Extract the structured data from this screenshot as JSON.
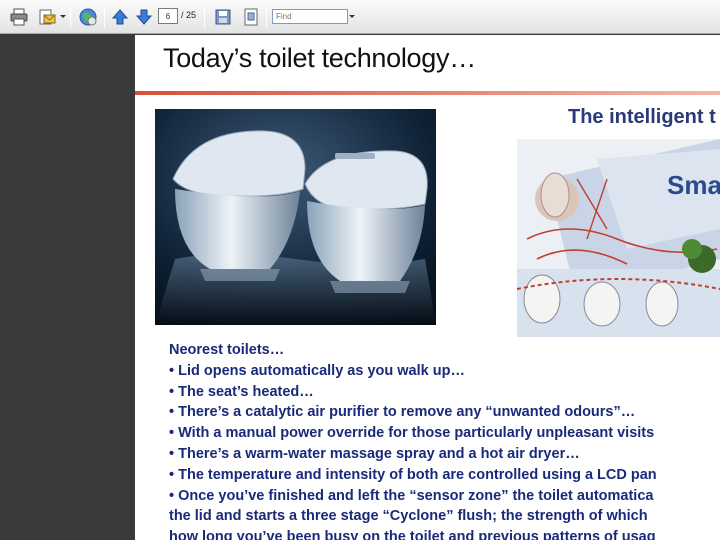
{
  "toolbar": {
    "page_current": "6",
    "page_separator": "/",
    "page_total": "25",
    "find_placeholder": "Find",
    "icons": [
      "print-icon",
      "email-icon",
      "globe-icon",
      "arrow-up-icon",
      "arrow-down-icon",
      "save-icon",
      "fit-page-icon"
    ]
  },
  "slide": {
    "title": "Today’s toilet technology…",
    "subtitle": "The intelligent t",
    "photo_text": "Sma",
    "lines": [
      "Neorest toilets…",
      "• Lid opens automatically as you walk up…",
      "• The seat’s heated…",
      "• There’s a catalytic air purifier to remove any “unwanted odours”…",
      "• With a manual power override for those particularly unpleasant visits",
      "• There’s a warm-water massage spray and a hot air dryer…",
      "• The temperature and intensity of both are controlled using a LCD pan",
      "• Once you’ve finished and left the “sensor zone” the toilet automatica",
      "the lid and starts a three stage “Cyclone” flush; the strength of which",
      "how long you’ve been busy on the toilet and previous patterns of usag"
    ]
  },
  "colors": {
    "title_rule": "#d94f3b",
    "body_text": "#1a2a7a",
    "subtitle": "#2a3a78",
    "background_panel": "#3a3a3a"
  }
}
